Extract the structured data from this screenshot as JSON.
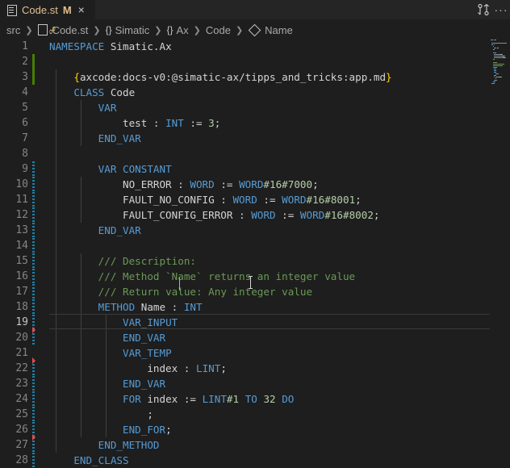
{
  "tab": {
    "filename": "Code.st",
    "modified_marker": "M",
    "close_glyph": "×",
    "icon": "file-lines-icon"
  },
  "toolbar": {
    "compare_icon": "compare-changes-icon",
    "more_glyph": "···"
  },
  "breadcrumb": {
    "folder": "src",
    "file": "Code.st",
    "ns1_icon": "{}",
    "ns1": "Simatic",
    "ns2_icon": "{}",
    "ns2": "Ax",
    "class": "Code",
    "method": "Name"
  },
  "editor": {
    "active_line": 19,
    "line_numbers": [
      "1",
      "2",
      "3",
      "4",
      "5",
      "6",
      "7",
      "8",
      "9",
      "10",
      "11",
      "12",
      "13",
      "14",
      "15",
      "16",
      "17",
      "18",
      "19",
      "20",
      "21",
      "22",
      "23",
      "24",
      "25",
      "26",
      "27",
      "28"
    ],
    "lines": [
      [
        [
          "k",
          "NAMESPACE"
        ],
        [
          "p",
          " Simatic.Ax"
        ]
      ],
      [],
      [
        [
          "p",
          "    "
        ],
        [
          "y",
          "{"
        ],
        [
          "p",
          "axcode:docs-v0:@simatic-ax/tipps_and_tricks:app.md"
        ],
        [
          "y",
          "}"
        ]
      ],
      [
        [
          "p",
          "    "
        ],
        [
          "k",
          "CLASS"
        ],
        [
          "p",
          " Code"
        ]
      ],
      [
        [
          "p",
          "        "
        ],
        [
          "k",
          "VAR"
        ]
      ],
      [
        [
          "p",
          "            test : "
        ],
        [
          "k",
          "INT"
        ],
        [
          "p",
          " := "
        ],
        [
          "n",
          "3"
        ],
        [
          "p",
          ";"
        ]
      ],
      [
        [
          "p",
          "        "
        ],
        [
          "k",
          "END_VAR"
        ]
      ],
      [],
      [
        [
          "p",
          "        "
        ],
        [
          "k",
          "VAR"
        ],
        [
          "p",
          " "
        ],
        [
          "k",
          "CONSTANT"
        ]
      ],
      [
        [
          "p",
          "            NO_ERROR : "
        ],
        [
          "k",
          "WORD"
        ],
        [
          "p",
          " := "
        ],
        [
          "k",
          "WORD"
        ],
        [
          "n",
          "#16#7000"
        ],
        [
          "p",
          ";"
        ]
      ],
      [
        [
          "p",
          "            FAULT_NO_CONFIG : "
        ],
        [
          "k",
          "WORD"
        ],
        [
          "p",
          " := "
        ],
        [
          "k",
          "WORD"
        ],
        [
          "n",
          "#16#8001"
        ],
        [
          "p",
          ";"
        ]
      ],
      [
        [
          "p",
          "            FAULT_CONFIG_ERROR : "
        ],
        [
          "k",
          "WORD"
        ],
        [
          "p",
          " := "
        ],
        [
          "k",
          "WORD"
        ],
        [
          "n",
          "#16#8002"
        ],
        [
          "p",
          ";"
        ]
      ],
      [
        [
          "p",
          "        "
        ],
        [
          "k",
          "END_VAR"
        ]
      ],
      [],
      [
        [
          "p",
          "        "
        ],
        [
          "c",
          "/// Description:"
        ]
      ],
      [
        [
          "p",
          "        "
        ],
        [
          "c",
          "/// Method `Name` returns an integer value"
        ]
      ],
      [
        [
          "p",
          "        "
        ],
        [
          "c",
          "/// Return value: Any integer value"
        ]
      ],
      [
        [
          "p",
          "        "
        ],
        [
          "k",
          "METHOD"
        ],
        [
          "p",
          " Name : "
        ],
        [
          "k",
          "INT"
        ]
      ],
      [
        [
          "p",
          "            "
        ],
        [
          "k",
          "VAR_INPUT"
        ]
      ],
      [
        [
          "p",
          "            "
        ],
        [
          "k",
          "END_VAR"
        ]
      ],
      [
        [
          "p",
          "            "
        ],
        [
          "k",
          "VAR_TEMP"
        ]
      ],
      [
        [
          "p",
          "                index : "
        ],
        [
          "k",
          "LINT"
        ],
        [
          "p",
          ";"
        ]
      ],
      [
        [
          "p",
          "            "
        ],
        [
          "k",
          "END_VAR"
        ]
      ],
      [
        [
          "p",
          "            "
        ],
        [
          "k",
          "FOR"
        ],
        [
          "p",
          " index := "
        ],
        [
          "k",
          "LINT"
        ],
        [
          "n",
          "#1"
        ],
        [
          "p",
          " "
        ],
        [
          "k",
          "TO"
        ],
        [
          "p",
          " "
        ],
        [
          "n",
          "32"
        ],
        [
          "p",
          " "
        ],
        [
          "k",
          "DO"
        ]
      ],
      [
        [
          "p",
          "                ;"
        ]
      ],
      [
        [
          "p",
          "            "
        ],
        [
          "k",
          "END_FOR"
        ],
        [
          "p",
          ";"
        ]
      ],
      [
        [
          "p",
          "        "
        ],
        [
          "k",
          "END_METHOD"
        ]
      ],
      [
        [
          "p",
          "    "
        ],
        [
          "k",
          "END_CLASS"
        ]
      ]
    ],
    "gutter": {
      "added": [
        2,
        3
      ],
      "modified": [
        9,
        10,
        11,
        12,
        13,
        14,
        15,
        16,
        17,
        18,
        19,
        20,
        22,
        23,
        24,
        25,
        26,
        27,
        28
      ],
      "deleted_after": [
        19,
        21,
        26
      ]
    }
  },
  "colors": {
    "background": "#1e1e1e",
    "keyword": "#569cd6",
    "number": "#b5cea8",
    "comment": "#6a9955",
    "bracket": "#ffd700",
    "gutter_added": "#487e02",
    "gutter_modified": "#1b81a8",
    "gutter_deleted": "#e14c4c",
    "tab_modified": "#e2c08d"
  }
}
